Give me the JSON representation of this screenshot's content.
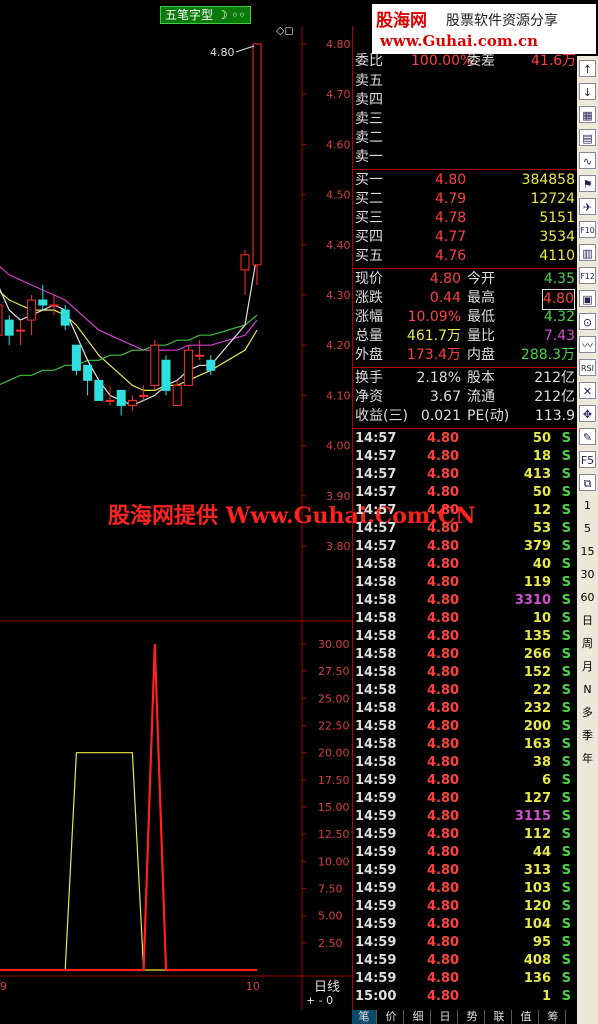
{
  "header": {
    "formula_tag": "五笔字型",
    "logo_main": "股海网",
    "logo_sub": "股票软件资源分享",
    "logo_url": "www.Guhai.com.cn",
    "corner_icons": "◇◻"
  },
  "watermark": "股海网提供 Www.Guhai.Com.CN",
  "price_axis": [
    "4.80",
    "4.70",
    "4.60",
    "4.50",
    "4.40",
    "4.30",
    "4.20",
    "4.10",
    "4.00",
    "3.90",
    "3.80"
  ],
  "price_annotation": "4.80",
  "indicator_axis": [
    "30.00",
    "27.50",
    "25.00",
    "22.50",
    "20.00",
    "17.50",
    "15.00",
    "12.50",
    "10.00",
    "7.50",
    "5.00",
    "2.50"
  ],
  "x_labels": {
    "left": "9",
    "right": "10"
  },
  "period_label": "日线",
  "zoom_controls": "+ - 0",
  "quote": {
    "partial_top": {
      "label": "委比",
      "value": "100.00%",
      "label2": "委差",
      "value2": "41.6万"
    },
    "sells": [
      {
        "label": "卖五"
      },
      {
        "label": "卖四"
      },
      {
        "label": "卖三"
      },
      {
        "label": "卖二"
      },
      {
        "label": "卖一"
      }
    ],
    "buys": [
      {
        "label": "买一",
        "price": "4.80",
        "vol": "384858"
      },
      {
        "label": "买二",
        "price": "4.79",
        "vol": "12724"
      },
      {
        "label": "买三",
        "price": "4.78",
        "vol": "5151"
      },
      {
        "label": "买四",
        "price": "4.77",
        "vol": "3534"
      },
      {
        "label": "买五",
        "price": "4.76",
        "vol": "4110"
      }
    ],
    "stats": [
      {
        "l1": "现价",
        "v1": "4.80",
        "l2": "今开",
        "v2": "4.35",
        "c1": "red",
        "c2": "grn"
      },
      {
        "l1": "涨跌",
        "v1": "0.44",
        "l2": "最高",
        "v2": "4.80",
        "c1": "red",
        "c2": "red"
      },
      {
        "l1": "涨幅",
        "v1": "10.09%",
        "l2": "最低",
        "v2": "4.32",
        "c1": "red",
        "c2": "grn"
      },
      {
        "l1": "总量",
        "v1": "461.7万",
        "l2": "量比",
        "v2": "7.43",
        "c1": "yel",
        "c2": "pur"
      },
      {
        "l1": "外盘",
        "v1": "173.4万",
        "l2": "内盘",
        "v2": "288.3万",
        "c1": "red",
        "c2": "grn"
      }
    ],
    "stats2": [
      {
        "l1": "换手",
        "v1": "2.18%",
        "l2": "股本",
        "v2": "212亿"
      },
      {
        "l1": "净资",
        "v1": "3.67",
        "l2": "流通",
        "v2": "212亿"
      },
      {
        "l1": "收益(三)",
        "v1": "0.021",
        "l2": "PE(动)",
        "v2": "113.9"
      }
    ]
  },
  "trades": [
    {
      "t": "14:57",
      "p": "4.80",
      "v": "50",
      "s": "S",
      "vc": "yel"
    },
    {
      "t": "14:57",
      "p": "4.80",
      "v": "18",
      "s": "S",
      "vc": "yel"
    },
    {
      "t": "14:57",
      "p": "4.80",
      "v": "413",
      "s": "S",
      "vc": "yel"
    },
    {
      "t": "14:57",
      "p": "4.80",
      "v": "50",
      "s": "S",
      "vc": "yel"
    },
    {
      "t": "14:57",
      "p": "4.80",
      "v": "12",
      "s": "S",
      "vc": "yel"
    },
    {
      "t": "14:57",
      "p": "4.80",
      "v": "53",
      "s": "S",
      "vc": "yel"
    },
    {
      "t": "14:57",
      "p": "4.80",
      "v": "379",
      "s": "S",
      "vc": "yel"
    },
    {
      "t": "14:58",
      "p": "4.80",
      "v": "40",
      "s": "S",
      "vc": "yel"
    },
    {
      "t": "14:58",
      "p": "4.80",
      "v": "119",
      "s": "S",
      "vc": "yel"
    },
    {
      "t": "14:58",
      "p": "4.80",
      "v": "3310",
      "s": "S",
      "vc": "pur"
    },
    {
      "t": "14:58",
      "p": "4.80",
      "v": "10",
      "s": "S",
      "vc": "yel"
    },
    {
      "t": "14:58",
      "p": "4.80",
      "v": "135",
      "s": "S",
      "vc": "yel"
    },
    {
      "t": "14:58",
      "p": "4.80",
      "v": "266",
      "s": "S",
      "vc": "yel"
    },
    {
      "t": "14:58",
      "p": "4.80",
      "v": "152",
      "s": "S",
      "vc": "yel"
    },
    {
      "t": "14:58",
      "p": "4.80",
      "v": "22",
      "s": "S",
      "vc": "yel"
    },
    {
      "t": "14:58",
      "p": "4.80",
      "v": "232",
      "s": "S",
      "vc": "yel"
    },
    {
      "t": "14:58",
      "p": "4.80",
      "v": "200",
      "s": "S",
      "vc": "yel"
    },
    {
      "t": "14:58",
      "p": "4.80",
      "v": "163",
      "s": "S",
      "vc": "yel"
    },
    {
      "t": "14:58",
      "p": "4.80",
      "v": "38",
      "s": "S",
      "vc": "yel"
    },
    {
      "t": "14:59",
      "p": "4.80",
      "v": "6",
      "s": "S",
      "vc": "yel"
    },
    {
      "t": "14:59",
      "p": "4.80",
      "v": "127",
      "s": "S",
      "vc": "yel"
    },
    {
      "t": "14:59",
      "p": "4.80",
      "v": "3115",
      "s": "S",
      "vc": "pur"
    },
    {
      "t": "14:59",
      "p": "4.80",
      "v": "112",
      "s": "S",
      "vc": "yel"
    },
    {
      "t": "14:59",
      "p": "4.80",
      "v": "44",
      "s": "S",
      "vc": "yel"
    },
    {
      "t": "14:59",
      "p": "4.80",
      "v": "313",
      "s": "S",
      "vc": "yel"
    },
    {
      "t": "14:59",
      "p": "4.80",
      "v": "103",
      "s": "S",
      "vc": "yel"
    },
    {
      "t": "14:59",
      "p": "4.80",
      "v": "120",
      "s": "S",
      "vc": "yel"
    },
    {
      "t": "14:59",
      "p": "4.80",
      "v": "104",
      "s": "S",
      "vc": "yel"
    },
    {
      "t": "14:59",
      "p": "4.80",
      "v": "95",
      "s": "S",
      "vc": "yel"
    },
    {
      "t": "14:59",
      "p": "4.80",
      "v": "408",
      "s": "S",
      "vc": "yel"
    },
    {
      "t": "14:59",
      "p": "4.80",
      "v": "136",
      "s": "S",
      "vc": "yel"
    },
    {
      "t": "15:00",
      "p": "4.80",
      "v": "1",
      "s": "S",
      "vc": "yel"
    }
  ],
  "bottom_tabs": [
    "笔",
    "价",
    "细",
    "日",
    "势",
    "联",
    "值",
    "筹"
  ],
  "toolbar": {
    "buttons": [
      "↑",
      "↓",
      "▦",
      "▤",
      "∿",
      "⚑",
      "✈",
      "F10",
      "▥",
      "F12",
      "▣",
      "⊙",
      "〰",
      "RSI",
      "✕",
      "✥",
      "✎",
      "F5",
      "⧉",
      "1",
      "5",
      "15",
      "30",
      "60",
      "日",
      "周",
      "月",
      "N",
      "多",
      "季",
      "年"
    ]
  },
  "chart_data": {
    "type": "candlestick",
    "price_ylim": [
      3.75,
      4.83
    ],
    "candles": [
      {
        "o": 4.22,
        "c": 4.28,
        "h": 4.31,
        "l": 4.2
      },
      {
        "o": 4.25,
        "c": 4.22,
        "h": 4.26,
        "l": 4.2
      },
      {
        "o": 4.23,
        "c": 4.23,
        "h": 4.25,
        "l": 4.2
      },
      {
        "o": 4.25,
        "c": 4.29,
        "h": 4.3,
        "l": 4.22
      },
      {
        "o": 4.29,
        "c": 4.28,
        "h": 4.32,
        "l": 4.27
      },
      {
        "o": 4.28,
        "c": 4.28,
        "h": 4.3,
        "l": 4.26
      },
      {
        "o": 4.27,
        "c": 4.24,
        "h": 4.28,
        "l": 4.23
      },
      {
        "o": 4.2,
        "c": 4.15,
        "h": 4.2,
        "l": 4.14
      },
      {
        "o": 4.16,
        "c": 4.13,
        "h": 4.16,
        "l": 4.1
      },
      {
        "o": 4.13,
        "c": 4.09,
        "h": 4.13,
        "l": 4.09
      },
      {
        "o": 4.09,
        "c": 4.09,
        "h": 4.12,
        "l": 4.08
      },
      {
        "o": 4.11,
        "c": 4.08,
        "h": 4.11,
        "l": 4.06
      },
      {
        "o": 4.08,
        "c": 4.09,
        "h": 4.1,
        "l": 4.07
      },
      {
        "o": 4.1,
        "c": 4.1,
        "h": 4.12,
        "l": 4.09
      },
      {
        "o": 4.12,
        "c": 4.2,
        "h": 4.21,
        "l": 4.11
      },
      {
        "o": 4.17,
        "c": 4.11,
        "h": 4.18,
        "l": 4.1
      },
      {
        "o": 4.08,
        "c": 4.12,
        "h": 4.13,
        "l": 4.08
      },
      {
        "o": 4.12,
        "c": 4.19,
        "h": 4.2,
        "l": 4.12
      },
      {
        "o": 4.18,
        "c": 4.18,
        "h": 4.21,
        "l": 4.17
      },
      {
        "o": 4.17,
        "c": 4.15,
        "h": 4.18,
        "l": 4.14
      },
      {
        "o": 4.35,
        "c": 4.38,
        "h": 4.39,
        "l": 4.3
      },
      {
        "o": 4.36,
        "c": 4.8,
        "h": 4.8,
        "l": 4.32
      }
    ],
    "ma_magenta": [
      4.36,
      4.34,
      4.33,
      4.32,
      4.31,
      4.3,
      4.29,
      4.27,
      4.25,
      4.23,
      4.22,
      4.21,
      4.2,
      4.19,
      4.19,
      4.19,
      4.19,
      4.2,
      4.2,
      4.2,
      4.22,
      4.25
    ],
    "ma_white": [
      4.32,
      4.27,
      4.25,
      4.26,
      4.27,
      4.28,
      4.27,
      4.22,
      4.17,
      4.13,
      4.1,
      4.09,
      4.08,
      4.09,
      4.1,
      4.12,
      4.13,
      4.15,
      4.16,
      4.16,
      4.24,
      4.38
    ],
    "ma_yellow": [
      4.31,
      4.29,
      4.28,
      4.27,
      4.27,
      4.27,
      4.26,
      4.24,
      4.21,
      4.18,
      4.16,
      4.14,
      4.12,
      4.11,
      4.11,
      4.12,
      4.12,
      4.13,
      4.14,
      4.15,
      4.19,
      4.23
    ],
    "ma_green": [
      4.12,
      4.13,
      4.14,
      4.14,
      4.15,
      4.15,
      4.16,
      4.16,
      4.17,
      4.17,
      4.18,
      4.18,
      4.19,
      4.19,
      4.2,
      4.2,
      4.21,
      4.21,
      4.22,
      4.22,
      4.24,
      4.26
    ],
    "indicator_ylim": [
      0,
      30
    ],
    "indicator_yellow": [
      0,
      0,
      0,
      0,
      0,
      0,
      0,
      20,
      20,
      20,
      20,
      20,
      20,
      0,
      0,
      0,
      0,
      0,
      0,
      0,
      0,
      0
    ],
    "indicator_red": [
      0,
      0,
      0,
      0,
      0,
      0,
      0,
      0,
      0,
      0,
      0,
      0,
      0,
      0,
      30,
      0,
      0,
      0,
      0,
      0,
      0,
      0
    ]
  }
}
